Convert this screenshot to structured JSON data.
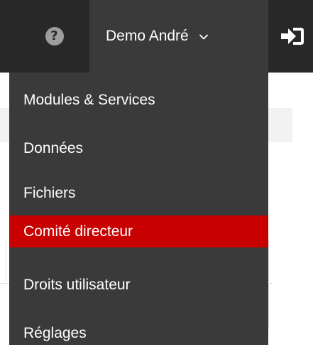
{
  "nav": {
    "user_label": "Demo André",
    "icons": {
      "help": "question-circle-icon",
      "chevron": "chevron-down-icon",
      "logout": "sign-out-icon"
    },
    "colors": {
      "bar": "#282828",
      "user_bg": "#3a3a3a",
      "text": "#ffffff"
    }
  },
  "help_glyph": "?",
  "dropdown": {
    "items": [
      {
        "label": "Modules & Services",
        "active": false
      },
      {
        "label": "Données",
        "active": false
      },
      {
        "label": "Fichiers",
        "active": false
      },
      {
        "label": "Comité directeur",
        "active": true
      },
      {
        "label": "Droits utilisateur",
        "active": false
      },
      {
        "label": "Réglages",
        "active": false
      }
    ],
    "colors": {
      "menu_bg": "#3a3a3a",
      "active_bg": "#c80000"
    }
  }
}
